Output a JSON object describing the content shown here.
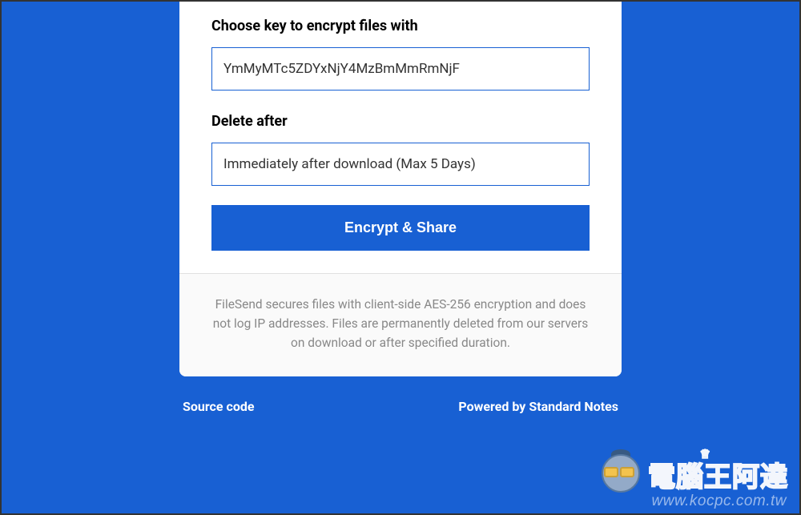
{
  "form": {
    "keyLabel": "Choose key to encrypt files with",
    "keyValue": "YmMyMTc5ZDYxNjY4MzBmMmRmNjF",
    "deleteLabel": "Delete after",
    "deleteValue": "Immediately after download (Max 5 Days)",
    "buttonLabel": "Encrypt & Share"
  },
  "footerNote": "FileSend secures files with client-side AES-256 encryption and does not log IP addresses. Files are permanently deleted from our servers on download or after specified duration.",
  "links": {
    "source": "Source code",
    "powered": "Powered by Standard Notes"
  },
  "watermark": {
    "cn": "電腦王阿達",
    "url": "www.kocpc.com.tw"
  }
}
